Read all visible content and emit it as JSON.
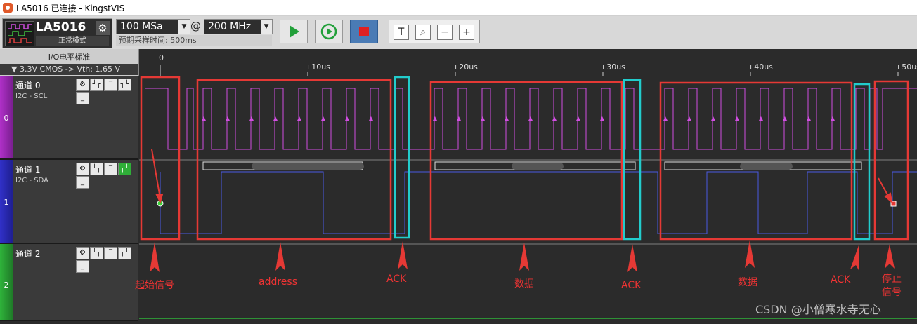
{
  "window": {
    "title": "LA5016 已连接 - KingstVIS"
  },
  "toolbar": {
    "device_name": "LA5016",
    "device_mode": "正常模式",
    "sample_count": "100 MSa",
    "at_symbol": "@",
    "sample_rate": "200 MHz",
    "predicted_time": "预期采样时间: 500ms",
    "buttons": [
      "run",
      "loop-run",
      "stop",
      "text-tool",
      "zoom-fit",
      "zoom-out",
      "zoom-in"
    ],
    "tool_glyphs": {
      "text": "T",
      "fit": "⌕",
      "out": "−",
      "in": "+"
    }
  },
  "io_level": {
    "label": "I/O电平标准",
    "value": "▼ 3.3V CMOS   -> Vth: 1.65 V"
  },
  "timeline": {
    "ticks": [
      "0",
      "+10us",
      "+20us",
      "+30us",
      "+40us",
      "+50us"
    ]
  },
  "channels": [
    {
      "index": "0",
      "name": "通道 0",
      "protocol": "I2C - SCL",
      "color": "#c63bd4"
    },
    {
      "index": "1",
      "name": "通道 1",
      "protocol": "I2C - SDA",
      "color": "#3b3bd4"
    },
    {
      "index": "2",
      "name": "通道 2",
      "protocol": "",
      "color": "#2fb33a"
    }
  ],
  "channel_tool_glyphs": [
    "⚙",
    "┘┌",
    "‾",
    "┐└",
    "_"
  ],
  "annotations": {
    "start": "起始信号",
    "address": "address",
    "ack1": "ACK",
    "data1": "数据",
    "ack2": "ACK",
    "data2": "数据",
    "ack3": "ACK",
    "stop_line1": "停止",
    "stop_line2": "信号"
  },
  "watermark": "CSDN @小僧寒水寺无心",
  "colors": {
    "highlight_red": "#e53935",
    "highlight_cyan": "#22cccc",
    "scl": "#d04ee0",
    "sda": "#4a58e0"
  }
}
